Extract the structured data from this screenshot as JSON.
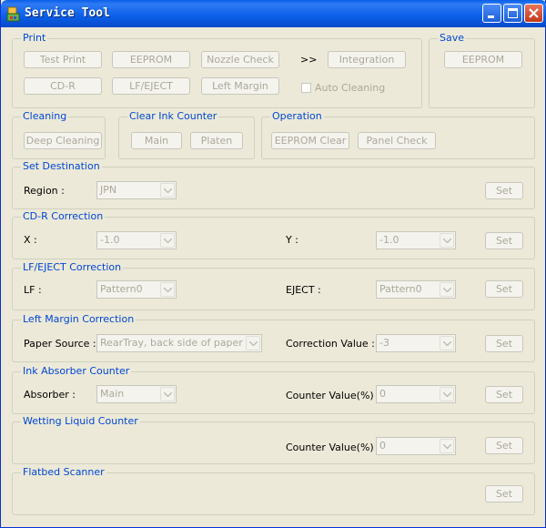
{
  "window": {
    "title": "Service Tool"
  },
  "print": {
    "label": "Print",
    "test_print": "Test Print",
    "eeprom": "EEPROM",
    "nozzle_check": "Nozzle Check",
    "arrow": ">>",
    "integration": "Integration",
    "cdr": "CD-R",
    "lf_eject": "LF/EJECT",
    "left_margin": "Left Margin",
    "auto_cleaning": "Auto Cleaning"
  },
  "save": {
    "label": "Save",
    "eeprom": "EEPROM"
  },
  "cleaning": {
    "label": "Cleaning",
    "deep_cleaning": "Deep Cleaning"
  },
  "clear_ink": {
    "label": "Clear Ink Counter",
    "main": "Main",
    "platen": "Platen"
  },
  "operation": {
    "label": "Operation",
    "eeprom_clear": "EEPROM Clear",
    "panel_check": "Panel Check"
  },
  "set_destination": {
    "label": "Set Destination",
    "region_label": "Region :",
    "region_value": "JPN",
    "set": "Set"
  },
  "cdr_correction": {
    "label": "CD-R Correction",
    "x_label": "X :",
    "x_value": "-1.0",
    "y_label": "Y :",
    "y_value": "-1.0",
    "set": "Set"
  },
  "lf_correction": {
    "label": "LF/EJECT Correction",
    "lf_label": "LF :",
    "lf_value": "Pattern0",
    "eject_label": "EJECT :",
    "eject_value": "Pattern0",
    "set": "Set"
  },
  "left_margin_correction": {
    "label": "Left Margin Correction",
    "paper_source_label": "Paper Source :",
    "paper_source_value": "RearTray, back side of paper",
    "correction_label": "Correction Value :",
    "correction_value": "-3",
    "set": "Set"
  },
  "ink_absorber": {
    "label": "Ink Absorber Counter",
    "absorber_label": "Absorber :",
    "absorber_value": "Main",
    "counter_label": "Counter Value(%) :",
    "counter_value": "0",
    "set": "Set"
  },
  "wetting_liquid": {
    "label": "Wetting Liquid Counter",
    "counter_label": "Counter Value(%) :",
    "counter_value": "0",
    "set": "Set"
  },
  "flatbed": {
    "label": "Flatbed Scanner",
    "set": "Set"
  },
  "colors": {
    "titlebar": "#0a5fe8",
    "face": "#ece9d8",
    "group_label": "#0046d5",
    "disabled_text": "#aca899"
  }
}
